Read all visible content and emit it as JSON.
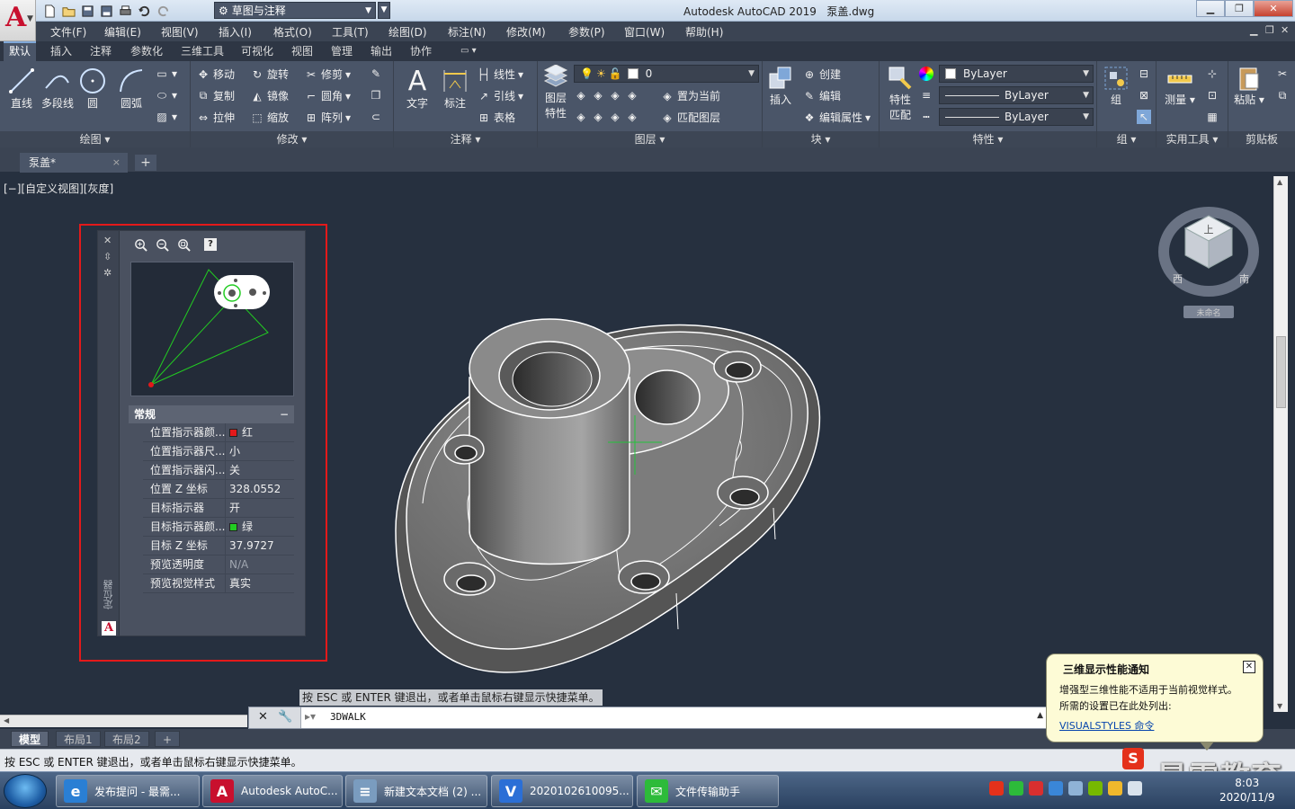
{
  "app": {
    "title": "Autodesk AutoCAD 2019",
    "filename": "泵盖.dwg",
    "workspace": "草图与注释"
  },
  "menu": [
    "文件(F)",
    "编辑(E)",
    "视图(V)",
    "插入(I)",
    "格式(O)",
    "工具(T)",
    "绘图(D)",
    "标注(N)",
    "修改(M)",
    "参数(P)",
    "窗口(W)",
    "帮助(H)"
  ],
  "ribbon_tabs": [
    "默认",
    "插入",
    "注释",
    "参数化",
    "三维工具",
    "可视化",
    "视图",
    "管理",
    "输出",
    "协作"
  ],
  "ribbon": {
    "draw": {
      "label": "绘图",
      "line": "直线",
      "polyline": "多段线",
      "circle": "圆",
      "arc": "圆弧"
    },
    "modify": {
      "label": "修改",
      "move": "移动",
      "rotate": "旋转",
      "trim": "修剪",
      "copy": "复制",
      "mirror": "镜像",
      "fillet": "圆角",
      "stretch": "拉伸",
      "scale": "缩放",
      "array": "阵列"
    },
    "annotation": {
      "label": "注释",
      "text": "文字",
      "dimension": "标注",
      "linear": "线性",
      "leader": "引线",
      "table": "表格"
    },
    "layers": {
      "label": "图层",
      "layer_props_1": "图层",
      "layer_props_2": "特性",
      "current_layer": "0",
      "set_current": "置为当前",
      "match_layer": "匹配图层"
    },
    "block": {
      "label": "块",
      "insert": "插入",
      "create": "创建",
      "edit": "编辑",
      "edit_attr": "编辑属性"
    },
    "properties": {
      "label": "特性",
      "match_1": "特性",
      "match_2": "匹配",
      "color": "ByLayer",
      "linetype": "ByLayer",
      "lineweight": "ByLayer"
    },
    "groups": {
      "label": "组",
      "group": "组"
    },
    "utilities": {
      "label": "实用工具",
      "measure": "测量"
    },
    "clipboard": {
      "label": "剪贴板",
      "paste": "粘贴"
    }
  },
  "file_tab": {
    "name": "泵盖*",
    "close": "×",
    "add": "+"
  },
  "viewport": {
    "label": "[−][自定义视图][灰度]"
  },
  "navigator": {
    "vertical_title": "定位器",
    "section": "常规",
    "collapse": "−",
    "properties": [
      {
        "key": "位置指示器颜...",
        "value": "红",
        "color": "#e3191a"
      },
      {
        "key": "位置指示器尺...",
        "value": "小"
      },
      {
        "key": "位置指示器闪...",
        "value": "关"
      },
      {
        "key": "位置 Z 坐标",
        "value": "328.0552"
      },
      {
        "key": "目标指示器",
        "value": "开"
      },
      {
        "key": "目标指示器颜...",
        "value": "绿",
        "color": "#22cc22"
      },
      {
        "key": "目标 Z 坐标",
        "value": "37.9727"
      },
      {
        "key": "预览透明度",
        "value": "N/A",
        "dim": true
      },
      {
        "key": "预览视觉样式",
        "value": "真实"
      }
    ]
  },
  "viewcube": {
    "top": "上",
    "west": "西",
    "south": "南",
    "unnamed": "未命名"
  },
  "command": {
    "hint": "按 ESC 或 ENTER 键退出，或者单击鼠标右键显示快捷菜单。",
    "current": "3DWALK",
    "close_icon": "✕",
    "wrench_icon": "🔧"
  },
  "layout_tabs": [
    "模型",
    "布局1",
    "布局2"
  ],
  "status": "按 ESC 或 ENTER 键退出，或者单击鼠标右键显示快捷菜单。",
  "notification": {
    "title": "三维显示性能通知",
    "line1": "增强型三维性能不适用于当前视觉样式。",
    "line2": "所需的设置已在此处列出:",
    "link": "VISUALSTYLES 命令"
  },
  "watermark": "最需教育",
  "taskbar": {
    "items": [
      {
        "label": "发布提问 - 最需...",
        "color": "#2a7fd4",
        "glyph": "e"
      },
      {
        "label": "Autodesk AutoC...",
        "color": "#c8102e",
        "glyph": "A"
      },
      {
        "label": "新建文本文档 (2) ...",
        "color": "#7a9cbf",
        "glyph": "≡"
      },
      {
        "label": "2020102610095...",
        "color": "#2b6fd6",
        "glyph": "V"
      },
      {
        "label": "文件传输助手",
        "color": "#2dbb3a",
        "glyph": "✉"
      }
    ],
    "time": "8:03",
    "date": "2020/11/9"
  }
}
